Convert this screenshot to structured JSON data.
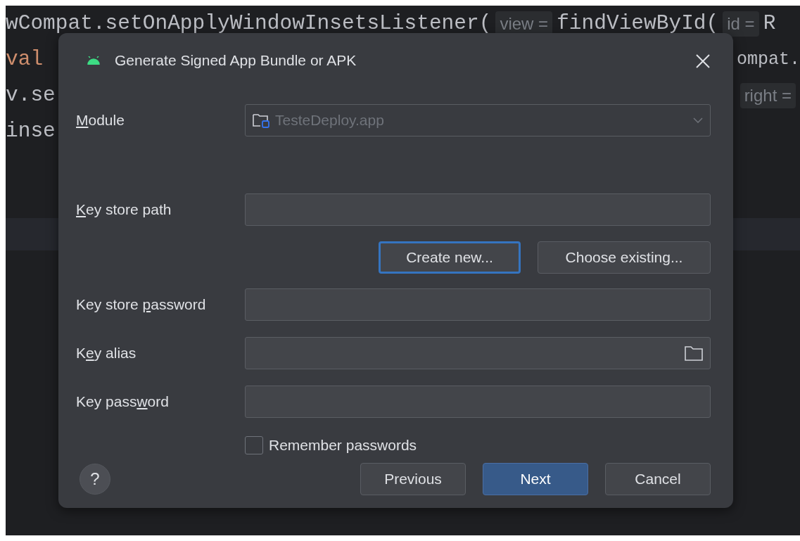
{
  "editor": {
    "lines": [
      {
        "left": [
          {
            "kind": "code",
            "text": "wCompat.setOnApplyWindowInsetsListener("
          },
          {
            "kind": "hint",
            "text": "view ="
          },
          {
            "kind": "code",
            "text": "findViewById("
          },
          {
            "kind": "hint",
            "text": "id ="
          },
          {
            "kind": "code",
            "text": "R"
          }
        ]
      },
      {
        "left": [
          {
            "kind": "keyword",
            "text": "val"
          }
        ],
        "right": [
          {
            "kind": "code",
            "text": "ompat."
          }
        ]
      },
      {
        "left": [
          {
            "kind": "code",
            "text": "v.se"
          }
        ],
        "right": [
          {
            "kind": "hint",
            "text": "right ="
          }
        ]
      },
      {
        "left": [
          {
            "kind": "code",
            "text": "inse"
          }
        ]
      }
    ]
  },
  "dialog": {
    "title": "Generate Signed App Bundle or APK",
    "module": {
      "label": {
        "key": "M",
        "after": "odule"
      },
      "value": "TesteDeploy.app",
      "disabled": true
    },
    "key_store_path": {
      "label": {
        "key": "K",
        "after": "ey store path"
      }
    },
    "key_store_buttons": [
      {
        "label": "Create new...",
        "focused": true
      },
      {
        "label": "Choose existing...",
        "focused": false
      }
    ],
    "fields": [
      {
        "label": {
          "before": "Key store ",
          "key": "p",
          "after": "assword"
        },
        "kind": "password"
      },
      {
        "label": {
          "before": "K",
          "key": "e",
          "after": "y alias"
        },
        "kind": "browse"
      },
      {
        "label": {
          "before": "Key pass",
          "key": "w",
          "after": "ord"
        },
        "kind": "password"
      }
    ],
    "remember_passwords": {
      "label": "Remember passwords",
      "checked": false
    },
    "help": "?",
    "buttons": [
      {
        "label": "Previous",
        "kind": "secondary"
      },
      {
        "label": "Next",
        "kind": "primary"
      },
      {
        "label": "Cancel",
        "kind": "secondary"
      }
    ]
  }
}
